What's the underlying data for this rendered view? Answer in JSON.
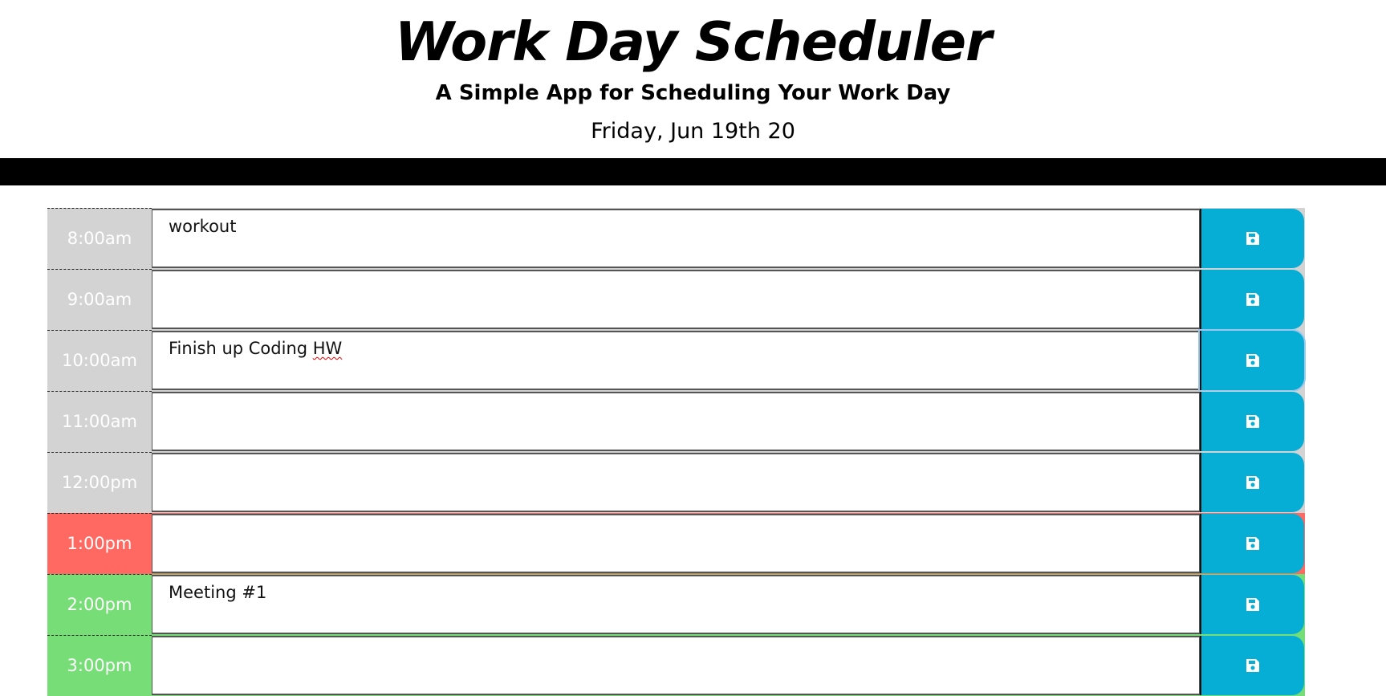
{
  "header": {
    "title": "Work Day Scheduler",
    "subtitle": "A Simple App for Scheduling Your Work Day",
    "current_date": "Friday, Jun 19th 20"
  },
  "colors": {
    "past": "#d3d3d3",
    "present": "#ff6961",
    "future": "#77dd77",
    "save_button": "#06aed5"
  },
  "save_icon": "floppy-disk-save-icon",
  "rows": [
    {
      "hour": "8:00am",
      "status": "past",
      "text": "workout"
    },
    {
      "hour": "9:00am",
      "status": "past",
      "text": ""
    },
    {
      "hour": "10:00am",
      "status": "past",
      "text": "Finish up Coding HW"
    },
    {
      "hour": "11:00am",
      "status": "past",
      "text": ""
    },
    {
      "hour": "12:00pm",
      "status": "past",
      "text": ""
    },
    {
      "hour": "1:00pm",
      "status": "present",
      "text": ""
    },
    {
      "hour": "2:00pm",
      "status": "future",
      "text": "Meeting #1"
    },
    {
      "hour": "3:00pm",
      "status": "future",
      "text": ""
    }
  ]
}
